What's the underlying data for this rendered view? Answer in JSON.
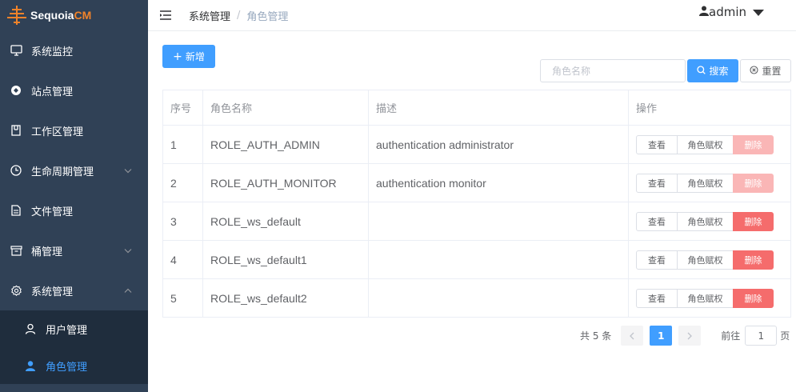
{
  "app": {
    "name_main": "Sequoia",
    "name_accent": "CM",
    "accent_color": "#f0832a"
  },
  "sidebar": {
    "items": [
      {
        "label": "系统监控",
        "icon": "monitor-icon"
      },
      {
        "label": "站点管理",
        "icon": "site-icon"
      },
      {
        "label": "工作区管理",
        "icon": "workspace-icon"
      },
      {
        "label": "生命周期管理",
        "icon": "clock-icon"
      },
      {
        "label": "文件管理",
        "icon": "file-icon"
      },
      {
        "label": "桶管理",
        "icon": "bucket-icon"
      },
      {
        "label": "系统管理",
        "icon": "gear-icon"
      }
    ],
    "sub_items": [
      {
        "label": "用户管理",
        "icon": "user-icon"
      },
      {
        "label": "角色管理",
        "icon": "user-filled-icon",
        "active": true
      }
    ]
  },
  "header": {
    "breadcrumb": {
      "first": "系统管理",
      "separator": "/",
      "current": "角色管理"
    },
    "user": "admin"
  },
  "toolbar": {
    "add_label": "新增",
    "search_placeholder": "角色名称",
    "search_label": "搜索",
    "reset_label": "重置"
  },
  "table": {
    "headers": {
      "idx": "序号",
      "name": "角色名称",
      "desc": "描述",
      "ops": "操作"
    },
    "op_labels": {
      "view": "查看",
      "grant": "角色赋权",
      "delete": "删除"
    },
    "rows": [
      {
        "idx": "1",
        "name": "ROLE_AUTH_ADMIN",
        "desc": "authentication administrator",
        "delete_disabled": true
      },
      {
        "idx": "2",
        "name": "ROLE_AUTH_MONITOR",
        "desc": "authentication monitor",
        "delete_disabled": true
      },
      {
        "idx": "3",
        "name": "ROLE_ws_default",
        "desc": "",
        "delete_disabled": false
      },
      {
        "idx": "4",
        "name": "ROLE_ws_default1",
        "desc": "",
        "delete_disabled": false
      },
      {
        "idx": "5",
        "name": "ROLE_ws_default2",
        "desc": "",
        "delete_disabled": false
      }
    ]
  },
  "pagination": {
    "total_label": "共 5 条",
    "current_page": "1",
    "goto_label": "前往",
    "goto_value": "1",
    "page_suffix": "页"
  },
  "colors": {
    "primary": "#409eff",
    "danger": "#f56c6c",
    "sidebar_bg": "#304156",
    "submenu_bg": "#1f2d3d"
  }
}
